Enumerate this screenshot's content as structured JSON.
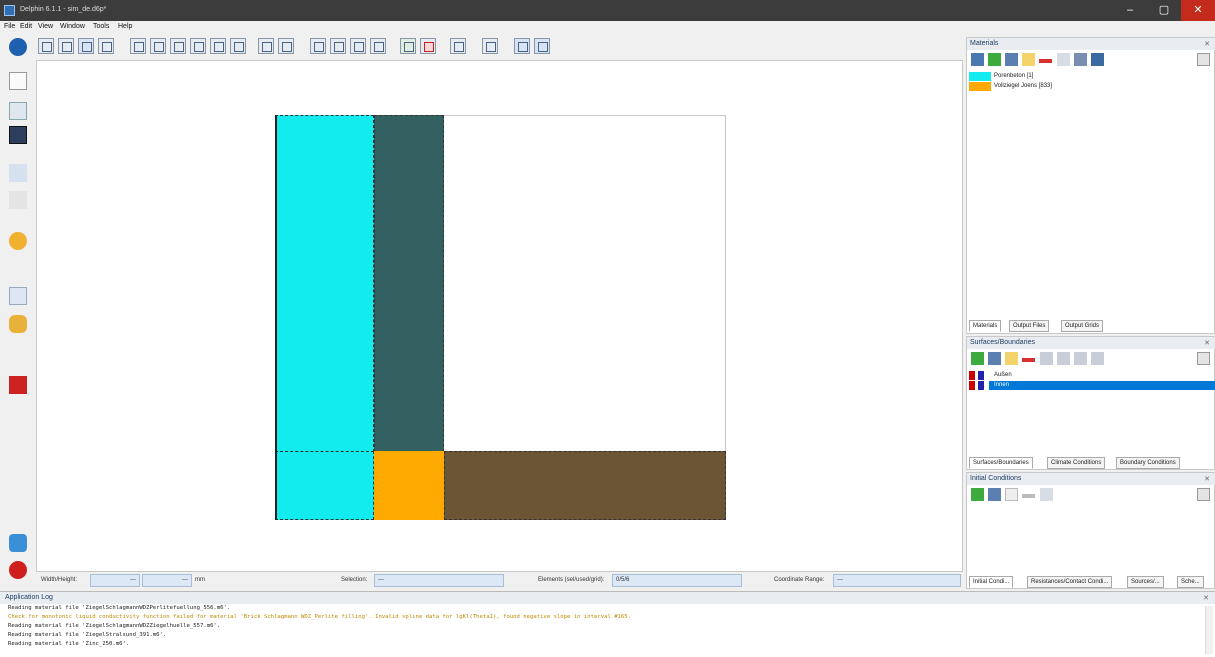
{
  "window": {
    "title": "Delphin 6.1.1 - sim_de.d6p*",
    "min": "–",
    "max": "▢",
    "close": "✕"
  },
  "menu": [
    "File",
    "Edit",
    "View",
    "Window",
    "Tools",
    "Help"
  ],
  "colors": {
    "cyan": "#13ecee",
    "teal": "#336161",
    "orange": "#ffaa00",
    "brown": "#6b5535",
    "selection": "#0078d7",
    "warning": "#c08a00"
  },
  "statusbar": {
    "width_height_label": "Width/Height:",
    "width_value": "---",
    "height_value": "---",
    "unit": "mm",
    "selection_label": "Selection:",
    "selection_value": "---",
    "elements_label": "Elements (sel/used/grid):",
    "elements_value": "0/5/6",
    "coord_label": "Coordinate Range:",
    "coord_value": "---"
  },
  "materials": {
    "title": "Materials",
    "items": [
      {
        "label": "Porenbeton [1]",
        "color": "#13ecee"
      },
      {
        "label": "Vollziegel Joens [833]",
        "color": "#ffaa00"
      }
    ],
    "tabs": [
      "Materials",
      "Output Files",
      "Output Grids"
    ]
  },
  "surfaces": {
    "title": "Surfaces/Boundaries",
    "items": [
      {
        "label": "Außen",
        "selected": false
      },
      {
        "label": "Innen",
        "selected": true
      }
    ],
    "tabs": [
      "Surfaces/Boundaries",
      "Climate Conditions",
      "Boundary Conditions"
    ]
  },
  "initial": {
    "title": "Initial Conditions",
    "tabs": [
      "Initial Condi...",
      "Resistances/Contact Condi...",
      "Sources/...",
      "Sche..."
    ]
  },
  "log": {
    "title": "Application Log",
    "lines": [
      {
        "text": "Reading material file 'ZiegelSchlagmannWDZPerlitefuellung_556.m6'.",
        "type": "info"
      },
      {
        "text": "Check for monotonic liquid conductivity function failed for material 'Brick Schlagmann WDZ_Perlite filling'. Invalid spline data for lgKl(Theta1), found negative slope in interval #165.",
        "type": "warning"
      },
      {
        "text": "Reading material file 'ZiegelSchlagmannWDZZiegelhuelle_557.m6'.",
        "type": "info"
      },
      {
        "text": "Reading material file 'ZiegelStralsund_391.m6'.",
        "type": "info"
      },
      {
        "text": "Reading material file 'Zinc_250.m6'.",
        "type": "info"
      }
    ]
  }
}
